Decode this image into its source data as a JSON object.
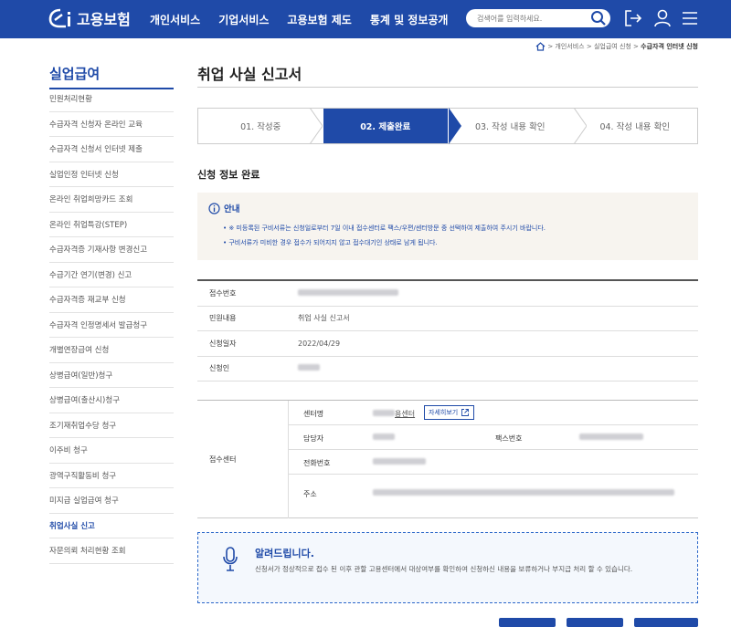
{
  "header": {
    "logo_text": "고용보험",
    "nav": [
      "개인서비스",
      "기업서비스",
      "고용보험 제도",
      "통계 및 정보공개"
    ],
    "search_placeholder": "검색어를 입력하세요.",
    "colors": {
      "primary": "#1f4aa8"
    }
  },
  "breadcrumb": {
    "items": [
      "개인서비스",
      "실업급여 신청"
    ],
    "current": "수급자격 인터넷 신청"
  },
  "sidebar": {
    "title": "실업급여",
    "items": [
      {
        "label": "민원처리현황"
      },
      {
        "label": "수급자격 신청자 온라인 교육"
      },
      {
        "label": "수급자격 신청서 인터넷 제출"
      },
      {
        "label": "실업인정 인터넷 신청"
      },
      {
        "label": "온라인 취업희망카드 조회"
      },
      {
        "label": "온라인 취업특강(STEP)"
      },
      {
        "label": "수급자격증 기재사항 변경신고"
      },
      {
        "label": "수급기간 연기(변경) 신고"
      },
      {
        "label": "수급자격증 재교부 신청"
      },
      {
        "label": "수급자격 인정명세서 발급청구"
      },
      {
        "label": "개별연장급여 신청"
      },
      {
        "label": "상병급여(일반)청구"
      },
      {
        "label": "상병급여(출산시)청구"
      },
      {
        "label": "조기재취업수당 청구"
      },
      {
        "label": "이주비 청구"
      },
      {
        "label": "광역구직활동비 청구"
      },
      {
        "label": "미지급 실업급여 청구"
      },
      {
        "label": "취업사실 신고"
      },
      {
        "label": "자문의뢰 처리현황 조회"
      }
    ],
    "active_index": 17
  },
  "main": {
    "title": "취업 사실 신고서",
    "steps": [
      "01. 작성중",
      "02. 제출완료",
      "03. 작성 내용 확인",
      "04. 작성 내용 확인"
    ],
    "active_step": 1,
    "section_title": "신청 정보 완료",
    "notice": {
      "title": "안내",
      "lines": [
        "• ※ 미등록된 구비서류는 신청일로부터 7일 이내 접수센터로 팩스/우편/센터방문 중 선택하여 제출하여 주시기 바랍니다.",
        "• 구비서류가 미비한 경우 접수가 되어지지 않고 접수대기인 상태로 남게 됩니다."
      ]
    },
    "info": {
      "receipt_no_label": "접수번호",
      "type_label": "민원내용",
      "type_value": "취업 사실 신고서",
      "date_label": "신청일자",
      "date_value": "2022/04/29",
      "applicant_label": "신청인"
    },
    "center": {
      "label": "접수센터",
      "name_label": "센터명",
      "name_suffix": "용센터",
      "detail_button": "자세히보기",
      "manager_label": "담당자",
      "fax_label": "팩스번호",
      "phone_label": "전화번호",
      "address_label": "주소"
    },
    "alert": {
      "title": "알려드립니다.",
      "text": "신청서가 정상적으로 접수 된 이후 관할 고용센터에서 대상여부를 확인하여 신청하신 내용을 보류하거나 부지급 처리 할 수 있습니다."
    }
  }
}
